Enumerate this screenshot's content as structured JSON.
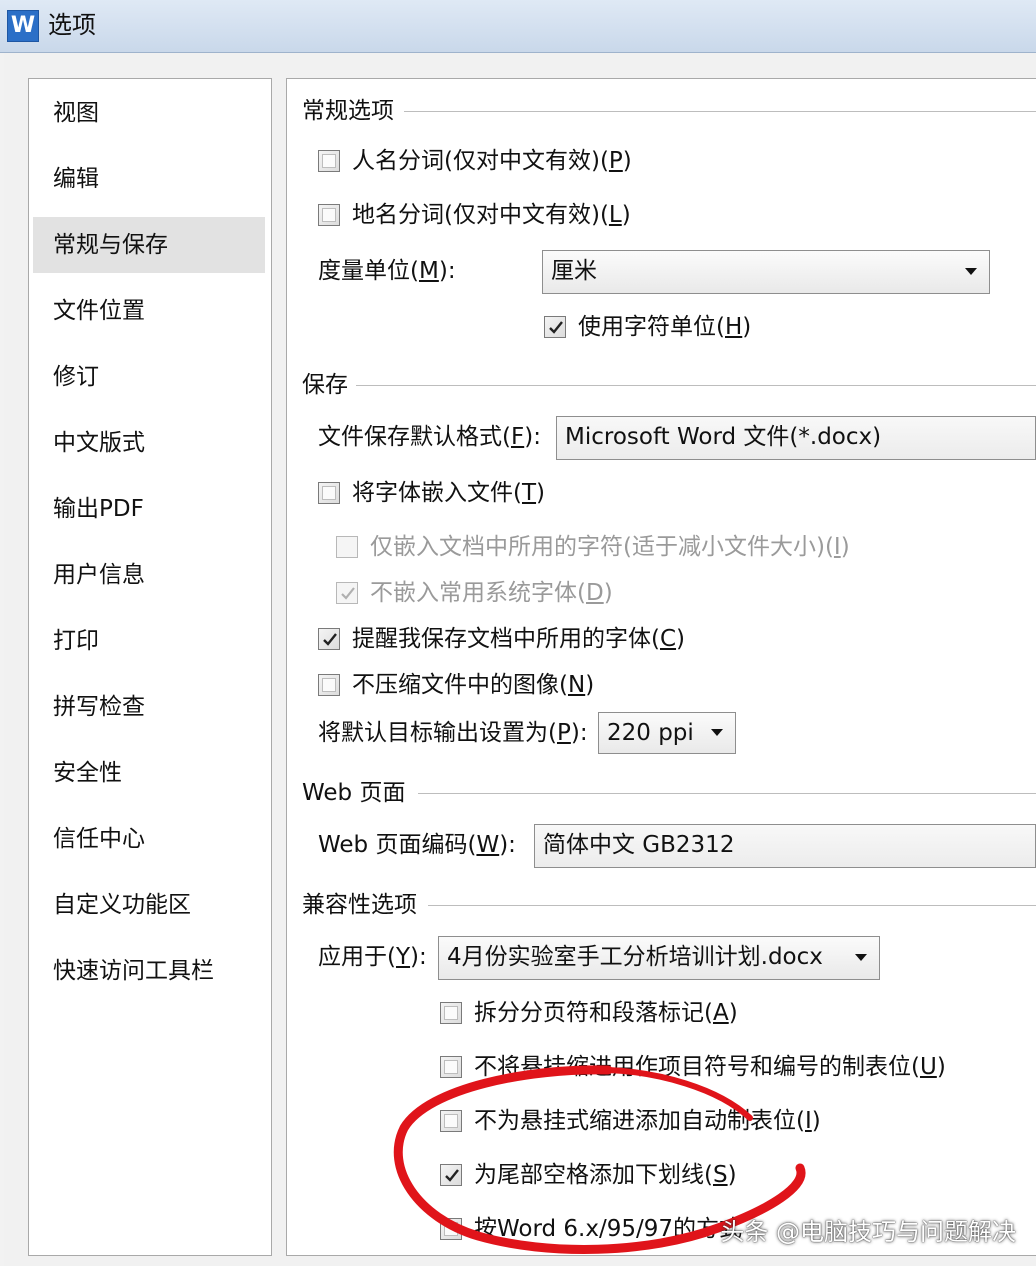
{
  "window": {
    "title": "选项",
    "icon_letter": "W"
  },
  "sidebar": {
    "items": [
      {
        "label": "视图"
      },
      {
        "label": "编辑"
      },
      {
        "label": "常规与保存",
        "selected": true
      },
      {
        "label": "文件位置"
      },
      {
        "label": "修订"
      },
      {
        "label": "中文版式"
      },
      {
        "label": "输出PDF"
      },
      {
        "label": "用户信息"
      },
      {
        "label": "打印"
      },
      {
        "label": "拼写检查"
      },
      {
        "label": "安全性"
      },
      {
        "label": "信任中心"
      },
      {
        "label": "自定义功能区"
      },
      {
        "label": "快速访问工具栏"
      }
    ]
  },
  "general": {
    "title": "常规选项",
    "person_name": {
      "label": "人名分词(仅对中文有效)(",
      "key": "P",
      "suffix": ")",
      "checked": false
    },
    "place_name": {
      "label": "地名分词(仅对中文有效)(",
      "key": "L",
      "suffix": ")",
      "checked": false
    },
    "unit": {
      "label": "度量单位(",
      "key": "M",
      "suffix": "):",
      "value": "厘米"
    },
    "char_unit": {
      "label": "使用字符单位(",
      "key": "H",
      "suffix": ")",
      "checked": true
    }
  },
  "save": {
    "title": "保存",
    "format": {
      "label": "文件保存默认格式(",
      "key": "F",
      "suffix": "):",
      "value": "Microsoft Word 文件(*.docx)"
    },
    "embed_fonts": {
      "label": "将字体嵌入文件(",
      "key": "T",
      "suffix": ")",
      "checked": false
    },
    "embed_used_only": {
      "label": "仅嵌入文档中所用的字符(适于减小文件大小)(",
      "key": "I",
      "suffix": ")",
      "checked": false,
      "disabled": true
    },
    "no_system_fonts": {
      "label": "不嵌入常用系统字体(",
      "key": "D",
      "suffix": ")",
      "checked": true,
      "disabled": true
    },
    "remind_fonts": {
      "label": "提醒我保存文档中所用的字体(",
      "key": "C",
      "suffix": ")",
      "checked": true
    },
    "no_compress": {
      "label": "不压缩文件中的图像(",
      "key": "N",
      "suffix": ")",
      "checked": false
    },
    "output": {
      "label": "将默认目标输出设置为(",
      "key": "P",
      "suffix": "):",
      "value": "220 ppi"
    }
  },
  "web": {
    "title": "Web 页面",
    "encoding": {
      "label": "Web 页面编码(",
      "key": "W",
      "suffix": "):",
      "value": "简体中文 GB2312"
    }
  },
  "compat": {
    "title": "兼容性选项",
    "apply_to": {
      "label": "应用于(",
      "key": "Y",
      "suffix": "):",
      "value": "4月份实验室手工分析培训计划.docx"
    },
    "split_page": {
      "label": "拆分分页符和段落标记(",
      "key": "A",
      "suffix": ")",
      "checked": false
    },
    "hang_indent_tab": {
      "label": "不将悬挂缩进用作项目符号和编号的制表位(",
      "key": "U",
      "suffix": ")",
      "checked": false
    },
    "no_auto_tab": {
      "label": "不为悬挂式缩进添加自动制表位(",
      "key": "I",
      "suffix": ")",
      "checked": false
    },
    "underline_trailing": {
      "label": "为尾部空格添加下划线(",
      "key": "S",
      "suffix": ")",
      "checked": true
    },
    "word6": {
      "label": "按Word 6.x/95/97的方式",
      "checked": false
    }
  },
  "watermark": "头条 @电脑技巧与问题解决",
  "colors": {
    "annotation": "#e0141a",
    "selected_bg": "#e2e2e2",
    "titlebar": "#c9d8ea"
  }
}
